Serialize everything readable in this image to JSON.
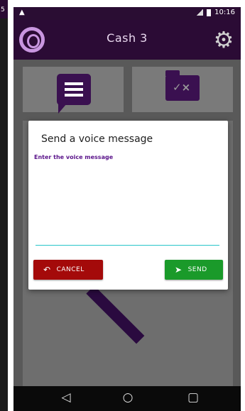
{
  "left_edge": {
    "digit": "5"
  },
  "statusbar": {
    "warning": "▲",
    "time": "10:16"
  },
  "appbar": {
    "title": "Cash 3"
  },
  "dialog": {
    "title": "Send a voice message",
    "hint": "Enter the voice message",
    "input_value": "",
    "cancel_label": "CANCEL",
    "send_label": "SEND"
  },
  "colors": {
    "appbar": "#2b0b35",
    "accent": "#3a1050",
    "cancel": "#a40a0a",
    "send": "#1a9a2a",
    "input_underline": "#27c4c9"
  },
  "icons": {
    "logo": "app-logo-icon",
    "settings": "gear-icon",
    "messages": "chat-message-icon",
    "folder": "folder-check-icon",
    "cancel": "undo-arrow-icon",
    "send": "send-arrow-icon",
    "nav_back": "back-triangle-icon",
    "nav_home": "home-circle-icon",
    "nav_recent": "recent-square-icon"
  }
}
